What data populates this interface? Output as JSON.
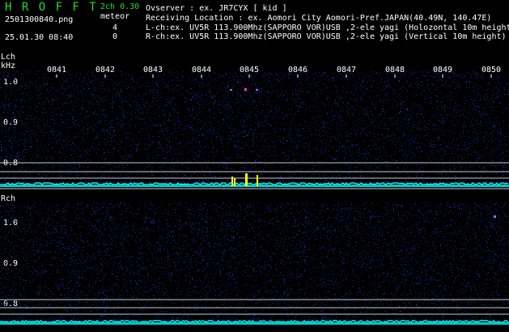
{
  "header": {
    "logo": "H R O F F T",
    "version": "2ch 0.30",
    "filename": "2501300840.png",
    "meteor_label": "meteor",
    "count_lch": "4",
    "count_rch": "0",
    "timestamp": "25.01.30 08:40",
    "observer": "Ovserver               : ex. JR7CYX [ kid ]",
    "location": "Receiving Location : ex. Aomori City Aomori-Pref.JAPAN(40.49N, 140.47E)",
    "lch": "L-ch:ex. UV5R 113.900Mhz(SAPPORO VOR)USB ,2-ele yagi (Holozontal 10m height",
    "rch": "R-ch:ex. UV5R 113.900Mhz(SAPPORO VOR)USB ,2-ele yagi (Vertical 10m height)"
  },
  "panels": {
    "lch_label": "Lch",
    "unit_label": "kHz",
    "rch_label": "Rch"
  },
  "y_ticks": [
    "1.0",
    "0.9",
    "0.8"
  ],
  "time_ticks": [
    "0841",
    "0842",
    "0843",
    "0844",
    "0845",
    "0846",
    "0847",
    "0848",
    "0849",
    "0850"
  ],
  "colors": {
    "background": "#000000",
    "noise": "#1a1a8a",
    "baseline": "#00ffff",
    "meteor": "#ffff00",
    "guide_line": "#c8c8c8",
    "logo": "#22dd22"
  }
}
